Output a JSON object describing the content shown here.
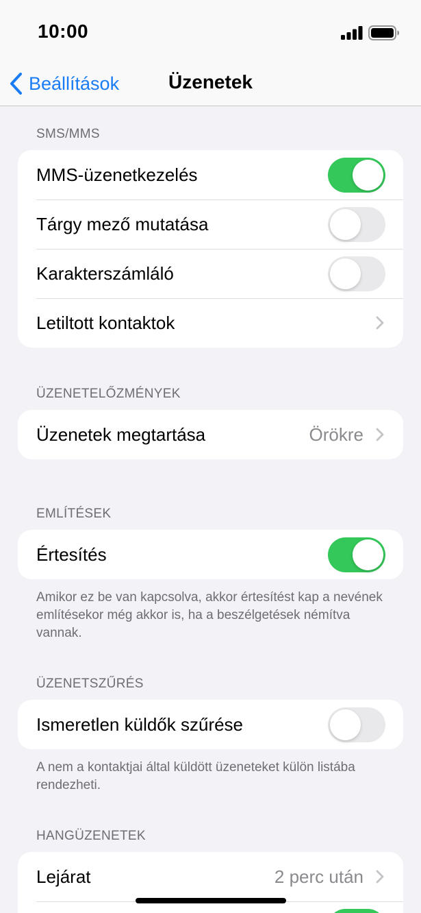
{
  "status_bar": {
    "time": "10:00"
  },
  "nav": {
    "back_label": "Beállítások",
    "title": "Üzenetek"
  },
  "colors": {
    "accent": "#1a7cf5",
    "toggle_on": "#34c759",
    "toggle_off": "#e9e9eb",
    "background": "#f2f2f7"
  },
  "sections": {
    "sms": {
      "header": "SMS/MMS",
      "rows": [
        {
          "label": "MMS-üzenetkezelés",
          "control": "toggle",
          "on": true
        },
        {
          "label": "Tárgy mező mutatása",
          "control": "toggle",
          "on": false
        },
        {
          "label": "Karakterszámláló",
          "control": "toggle",
          "on": false
        },
        {
          "label": "Letiltott kontaktok",
          "control": "chevron"
        }
      ]
    },
    "history": {
      "header": "ÜZENETELŐZMÉNYEK",
      "rows": [
        {
          "label": "Üzenetek megtartása",
          "value": "Örökre",
          "control": "chevron"
        }
      ]
    },
    "mentions": {
      "header": "EMLÍTÉSEK",
      "rows": [
        {
          "label": "Értesítés",
          "control": "toggle",
          "on": true
        }
      ],
      "footer": "Amikor ez be van kapcsolva, akkor értesítést kap a nevének említésekor még akkor is, ha a beszélgetések némítva vannak."
    },
    "filtering": {
      "header": "ÜZENETSZŰRÉS",
      "rows": [
        {
          "label": "Ismeretlen küldők szűrése",
          "control": "toggle",
          "on": false
        }
      ],
      "footer": "A nem a kontaktjai által küldött üzeneteket külön listába rendezheti."
    },
    "audio": {
      "header": "HANGÜZENETEK",
      "rows": [
        {
          "label": "Lejárat",
          "value": "2 perc után",
          "control": "chevron"
        }
      ]
    }
  }
}
